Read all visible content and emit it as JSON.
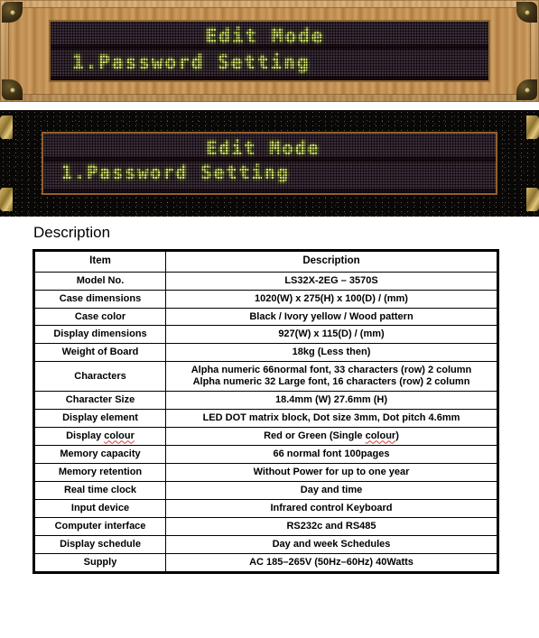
{
  "panels": [
    {
      "id": "wood-frame-led-sign",
      "frame_style": "wood",
      "line1": "Edit Mode",
      "line2": "1.Password Setting",
      "led_color": "#cfe06a",
      "screen_bg": "#2b1a28"
    },
    {
      "id": "dark-frame-led-sign",
      "frame_style": "black-speckled",
      "line1": "Edit Mode",
      "line2": "1.Password Setting",
      "led_color": "#cfe06a",
      "screen_bg": "#2b1a28"
    }
  ],
  "heading": "Description",
  "table": {
    "headers": [
      "Item",
      "Description"
    ],
    "rows": [
      {
        "item": "Model No.",
        "desc": "LS32X-2EG – 3570S"
      },
      {
        "item": "Case dimensions",
        "desc": "1020(W) x 275(H) x 100(D) / (mm)"
      },
      {
        "item": "Case color",
        "desc": "Black / Ivory yellow / Wood pattern"
      },
      {
        "item": "Display dimensions",
        "desc": "927(W) x 115(D) / (mm)"
      },
      {
        "item": "Weight of Board",
        "desc": "18kg (Less then)"
      },
      {
        "item": "Characters",
        "desc_line1": "Alpha numeric 66normal font,  33 characters (row) 2 column",
        "desc_line2": "Alpha numeric 32 Large font,   16 characters (row) 2 column"
      },
      {
        "item": "Character Size",
        "desc": "18.4mm (W) 27.6mm (H)"
      },
      {
        "item": "Display element",
        "desc": "LED DOT matrix block, Dot size 3mm, Dot pitch 4.6mm"
      },
      {
        "item_pre": "Display ",
        "item_misspelled": "colour",
        "desc_pre": "Red or Green (Single ",
        "desc_misspelled": "colour",
        "desc_post": ")"
      },
      {
        "item": "Memory capacity",
        "desc": "66 normal font 100pages"
      },
      {
        "item": "Memory retention",
        "desc": "Without Power for up to one year"
      },
      {
        "item": "Real time clock",
        "desc": "Day and time"
      },
      {
        "item": "Input device",
        "desc": "Infrared control Keyboard"
      },
      {
        "item": "Computer interface",
        "desc": "RS232c and RS485"
      },
      {
        "item": "Display schedule",
        "desc": "Day and week Schedules"
      },
      {
        "item": "Supply",
        "desc": "AC 185–265V (50Hz–60Hz) 40Watts"
      }
    ]
  }
}
